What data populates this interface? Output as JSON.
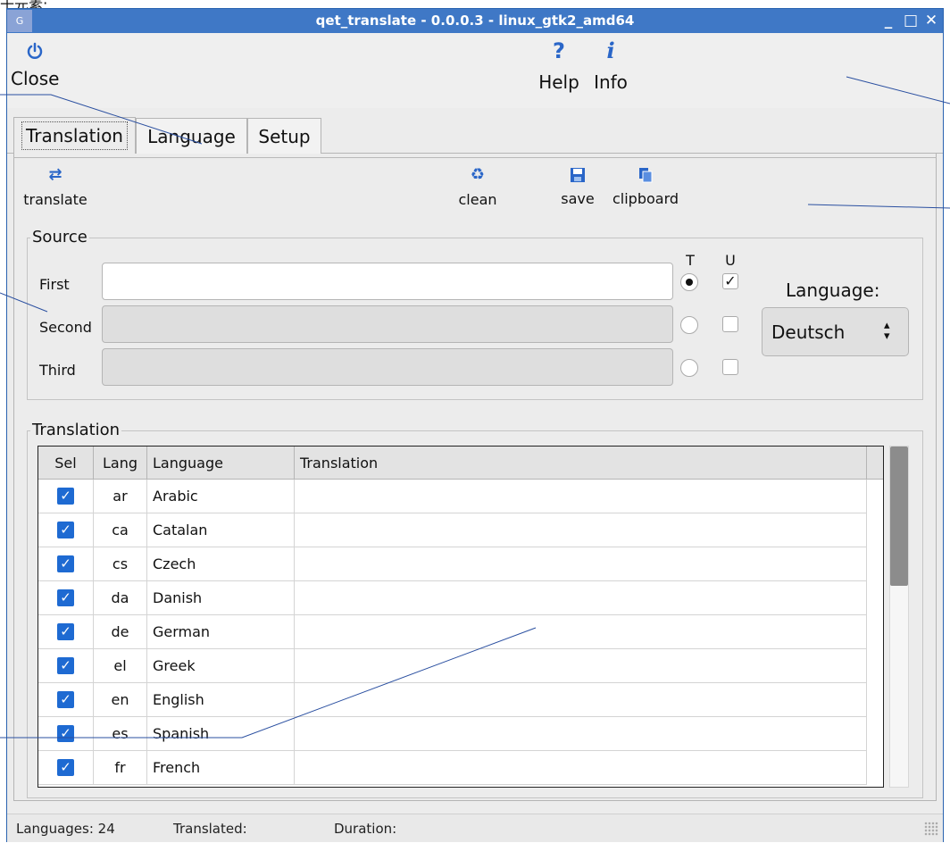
{
  "window": {
    "title": "qet_translate - 0.0.0.3 - linux_gtk2_amd64",
    "app_icon_text": "G",
    "minimize": "_",
    "maximize": "□",
    "close": "✕"
  },
  "corner_text": "十元素:",
  "toolbar": {
    "close_label": "Close",
    "help_label": "Help",
    "info_label": "Info",
    "icons": {
      "close": "power-icon",
      "help": "question-icon",
      "info": "info-icon"
    }
  },
  "tabs": [
    {
      "label": "Translation",
      "active": true
    },
    {
      "label": "Language",
      "active": false
    },
    {
      "label": "Setup",
      "active": false
    }
  ],
  "actions": {
    "translate_label": "translate",
    "clean_label": "clean",
    "save_label": "save",
    "clipboard_label": "clipboard"
  },
  "source": {
    "legend": "Source",
    "col_t": "T",
    "col_u": "U",
    "rows": [
      {
        "label": "First",
        "value": "",
        "enabled": true,
        "radio": true,
        "check": true
      },
      {
        "label": "Second",
        "value": "",
        "enabled": false,
        "radio": false,
        "check": false
      },
      {
        "label": "Third",
        "value": "",
        "enabled": false,
        "radio": false,
        "check": false
      }
    ],
    "language_label": "Language:",
    "language_value": "Deutsch"
  },
  "translation": {
    "legend": "Translation",
    "columns": [
      "Sel",
      "Lang",
      "Language",
      "Translation"
    ],
    "rows": [
      {
        "sel": true,
        "code": "ar",
        "language": "Arabic",
        "translation": ""
      },
      {
        "sel": true,
        "code": "ca",
        "language": "Catalan",
        "translation": ""
      },
      {
        "sel": true,
        "code": "cs",
        "language": "Czech",
        "translation": ""
      },
      {
        "sel": true,
        "code": "da",
        "language": "Danish",
        "translation": ""
      },
      {
        "sel": true,
        "code": "de",
        "language": "German",
        "translation": ""
      },
      {
        "sel": true,
        "code": "el",
        "language": "Greek",
        "translation": ""
      },
      {
        "sel": true,
        "code": "en",
        "language": "English",
        "translation": ""
      },
      {
        "sel": true,
        "code": "es",
        "language": "Spanish",
        "translation": ""
      },
      {
        "sel": true,
        "code": "fr",
        "language": "French",
        "translation": ""
      }
    ]
  },
  "status": {
    "languages": "Languages: 24",
    "translated": "Translated:",
    "duration": "Duration:"
  },
  "colors": {
    "titlebar": "#3f78c6",
    "accent": "#1e6ad2",
    "annotation": "#2a4fa0"
  }
}
